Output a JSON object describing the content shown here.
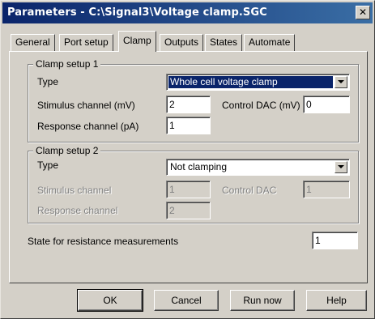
{
  "window": {
    "title": "Parameters - C:\\Signal3\\Voltage clamp.SGC",
    "close_glyph": "✕"
  },
  "tabs": [
    {
      "label": "General"
    },
    {
      "label": "Port setup"
    },
    {
      "label": "Clamp",
      "active": true
    },
    {
      "label": "Outputs"
    },
    {
      "label": "States"
    },
    {
      "label": "Automate"
    }
  ],
  "clamp1": {
    "title": "Clamp setup 1",
    "type_label": "Type",
    "type_value": "Whole cell voltage clamp",
    "stimulus_label": "Stimulus channel (mV)",
    "stimulus_value": "2",
    "control_dac_label": "Control DAC (mV)",
    "control_dac_value": "0",
    "response_label": "Response channel (pA)",
    "response_value": "1"
  },
  "clamp2": {
    "title": "Clamp setup 2",
    "type_label": "Type",
    "type_value": "Not clamping",
    "stimulus_label": "Stimulus channel",
    "stimulus_value": "1",
    "control_dac_label": "Control DAC",
    "control_dac_value": "1",
    "response_label": "Response channel",
    "response_value": "2"
  },
  "resistance": {
    "label": "State for resistance measurements",
    "value": "1"
  },
  "buttons": {
    "ok": "OK",
    "cancel": "Cancel",
    "run_now": "Run now",
    "help": "Help"
  }
}
